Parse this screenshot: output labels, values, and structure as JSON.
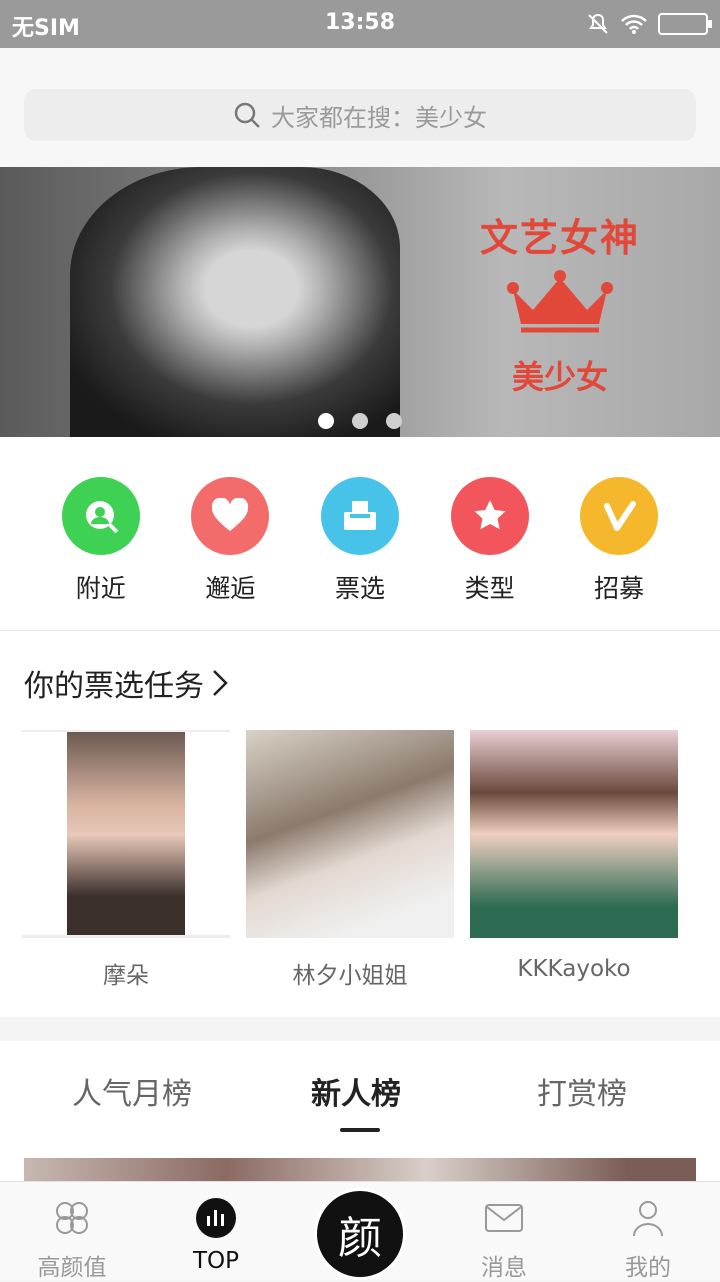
{
  "status": {
    "carrier": "无SIM",
    "time": "13:58"
  },
  "search": {
    "placeholder": "大家都在搜：美少女"
  },
  "banner": {
    "line1": "文艺女神",
    "line2": "美少女",
    "slides": 3,
    "active_slide": 0
  },
  "quick_actions": [
    {
      "label": "附近",
      "icon": "nearby-person-icon",
      "color": "#3ed153"
    },
    {
      "label": "邂逅",
      "icon": "heart-icon",
      "color": "#f36b6b"
    },
    {
      "label": "票选",
      "icon": "ballot-box-icon",
      "color": "#47c3ea"
    },
    {
      "label": "类型",
      "icon": "star-icon",
      "color": "#f2555c"
    },
    {
      "label": "招募",
      "icon": "v-badge-icon",
      "color": "#f5b82c"
    }
  ],
  "tasks": {
    "title": "你的票选任务",
    "cards": [
      {
        "name": "摩朵"
      },
      {
        "name": "林夕小姐姐"
      },
      {
        "name": "KKKayoko"
      }
    ]
  },
  "rank_tabs": [
    {
      "label": "人气月榜",
      "active": false
    },
    {
      "label": "新人榜",
      "active": true
    },
    {
      "label": "打赏榜",
      "active": false
    }
  ],
  "tabbar": {
    "items": [
      {
        "label": "高颜值",
        "icon": "clover-icon"
      },
      {
        "label": "TOP",
        "icon": "bar-chart-icon"
      },
      {
        "label": "颜",
        "icon": "center-brand"
      },
      {
        "label": "消息",
        "icon": "envelope-icon"
      },
      {
        "label": "我的",
        "icon": "user-icon"
      }
    ]
  }
}
